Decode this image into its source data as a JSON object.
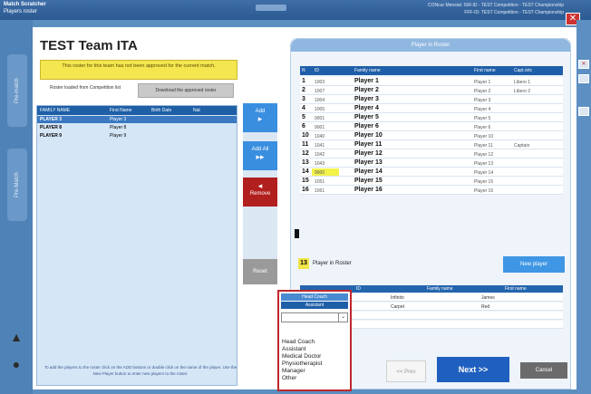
{
  "window": {
    "title_line1": "Match Scratcher",
    "title_line2": "Players roster",
    "right_line1": "CONcur Mensial: ISR-ID - TEST Competition - TEST Championship",
    "right_line2": "FFF-ID: TEST Competition - TEST Championship",
    "close_label": "✕"
  },
  "team": {
    "title": "TEST Team ITA",
    "warning": "This roster for this team has not been approved for the current match.",
    "roster_loaded": "Roster loaded from Competition list",
    "download_label": "Download the approved roster",
    "list_headers": [
      "FAMILY NAME",
      "First Name",
      "Birth Date",
      "Nat"
    ],
    "list_rows": [
      {
        "family": "PLAYER 3",
        "first": "Player 3"
      },
      {
        "family": "PLAYER 8",
        "first": "Player 8"
      },
      {
        "family": "PLAYER 9",
        "first": "Player 9"
      }
    ],
    "bottom_note": "To add the players to the roster click on the ADD buttons or double click on the name of the player. Use the New Player button to enter new players to the roster."
  },
  "side": {
    "tab1": "Pre-match",
    "tab2": "Pre-Match",
    "icon1": "car-icon",
    "icon2": "person-icon"
  },
  "middle": {
    "add_label": "Add",
    "add_all_label": "Add All",
    "remove_label": "Remove",
    "reset_label": "Reset"
  },
  "roster": {
    "header": "Player in Roster",
    "columns": [
      "N",
      "ID",
      "Family name",
      "First name",
      "Capt./etc"
    ],
    "rows": [
      {
        "num": "1",
        "id": "1003",
        "family": "Player 1",
        "first": "Player 1",
        "cap": "Libero 1"
      },
      {
        "num": "2",
        "id": "1007",
        "family": "Player 2",
        "first": "Player 2",
        "cap": "Libero 2"
      },
      {
        "num": "3",
        "id": "1004",
        "family": "Player 3",
        "first": "Player 3",
        "cap": ""
      },
      {
        "num": "4",
        "id": "1005",
        "family": "Player 4",
        "first": "Player 4",
        "cap": ""
      },
      {
        "num": "5",
        "id": "9001",
        "family": "Player 5",
        "first": "Player 5",
        "cap": ""
      },
      {
        "num": "6",
        "id": "9001",
        "family": "Player 6",
        "first": "Player 6",
        "cap": ""
      },
      {
        "num": "10",
        "id": "1040",
        "family": "Player 10",
        "first": "Player 10",
        "cap": ""
      },
      {
        "num": "11",
        "id": "1041",
        "family": "Player 11",
        "first": "Player 11",
        "cap": "Captain"
      },
      {
        "num": "12",
        "id": "1042",
        "family": "Player 12",
        "first": "Player 12",
        "cap": ""
      },
      {
        "num": "13",
        "id": "1043",
        "family": "Player 13",
        "first": "Player 13",
        "cap": ""
      },
      {
        "num": "14",
        "id": "9000",
        "family": "Player 14",
        "first": "Player 14",
        "cap": ""
      },
      {
        "num": "15",
        "id": "1051",
        "family": "Player 15",
        "first": "Player 15",
        "cap": ""
      },
      {
        "num": "16",
        "id": "1061",
        "family": "Player 16",
        "first": "Player 16",
        "cap": ""
      }
    ],
    "count": "13",
    "count_label": "Player in Roster",
    "new_player_label": "New player",
    "officials_columns": [
      "",
      "ID",
      "Family name",
      "First name"
    ],
    "officials_rows": [
      {
        "role": "",
        "id": "",
        "family": "Infinito",
        "first": "James"
      },
      {
        "role": "",
        "id": "",
        "family": "Carpet",
        "first": "Red"
      },
      {
        "role": "",
        "id": "",
        "family": "",
        "first": ""
      },
      {
        "role": "",
        "id": "",
        "family": "",
        "first": ""
      }
    ]
  },
  "dropdown": {
    "option_top": "Head Coach",
    "option_selected": "Assistant",
    "arrow": "⌄",
    "options": [
      "Head Coach",
      "Assistant",
      "Medical Doctor",
      "Physiotherapist",
      "Manager",
      "Other"
    ]
  },
  "footer": {
    "prev_label": "<< Prev",
    "next_label": "Next >>",
    "cancel_label": "Cancel"
  },
  "colors": {
    "accent": "#1f5fbf",
    "remove": "#b11f1f",
    "warning": "#f3e64f",
    "dropdown_border": "#c0272d"
  }
}
